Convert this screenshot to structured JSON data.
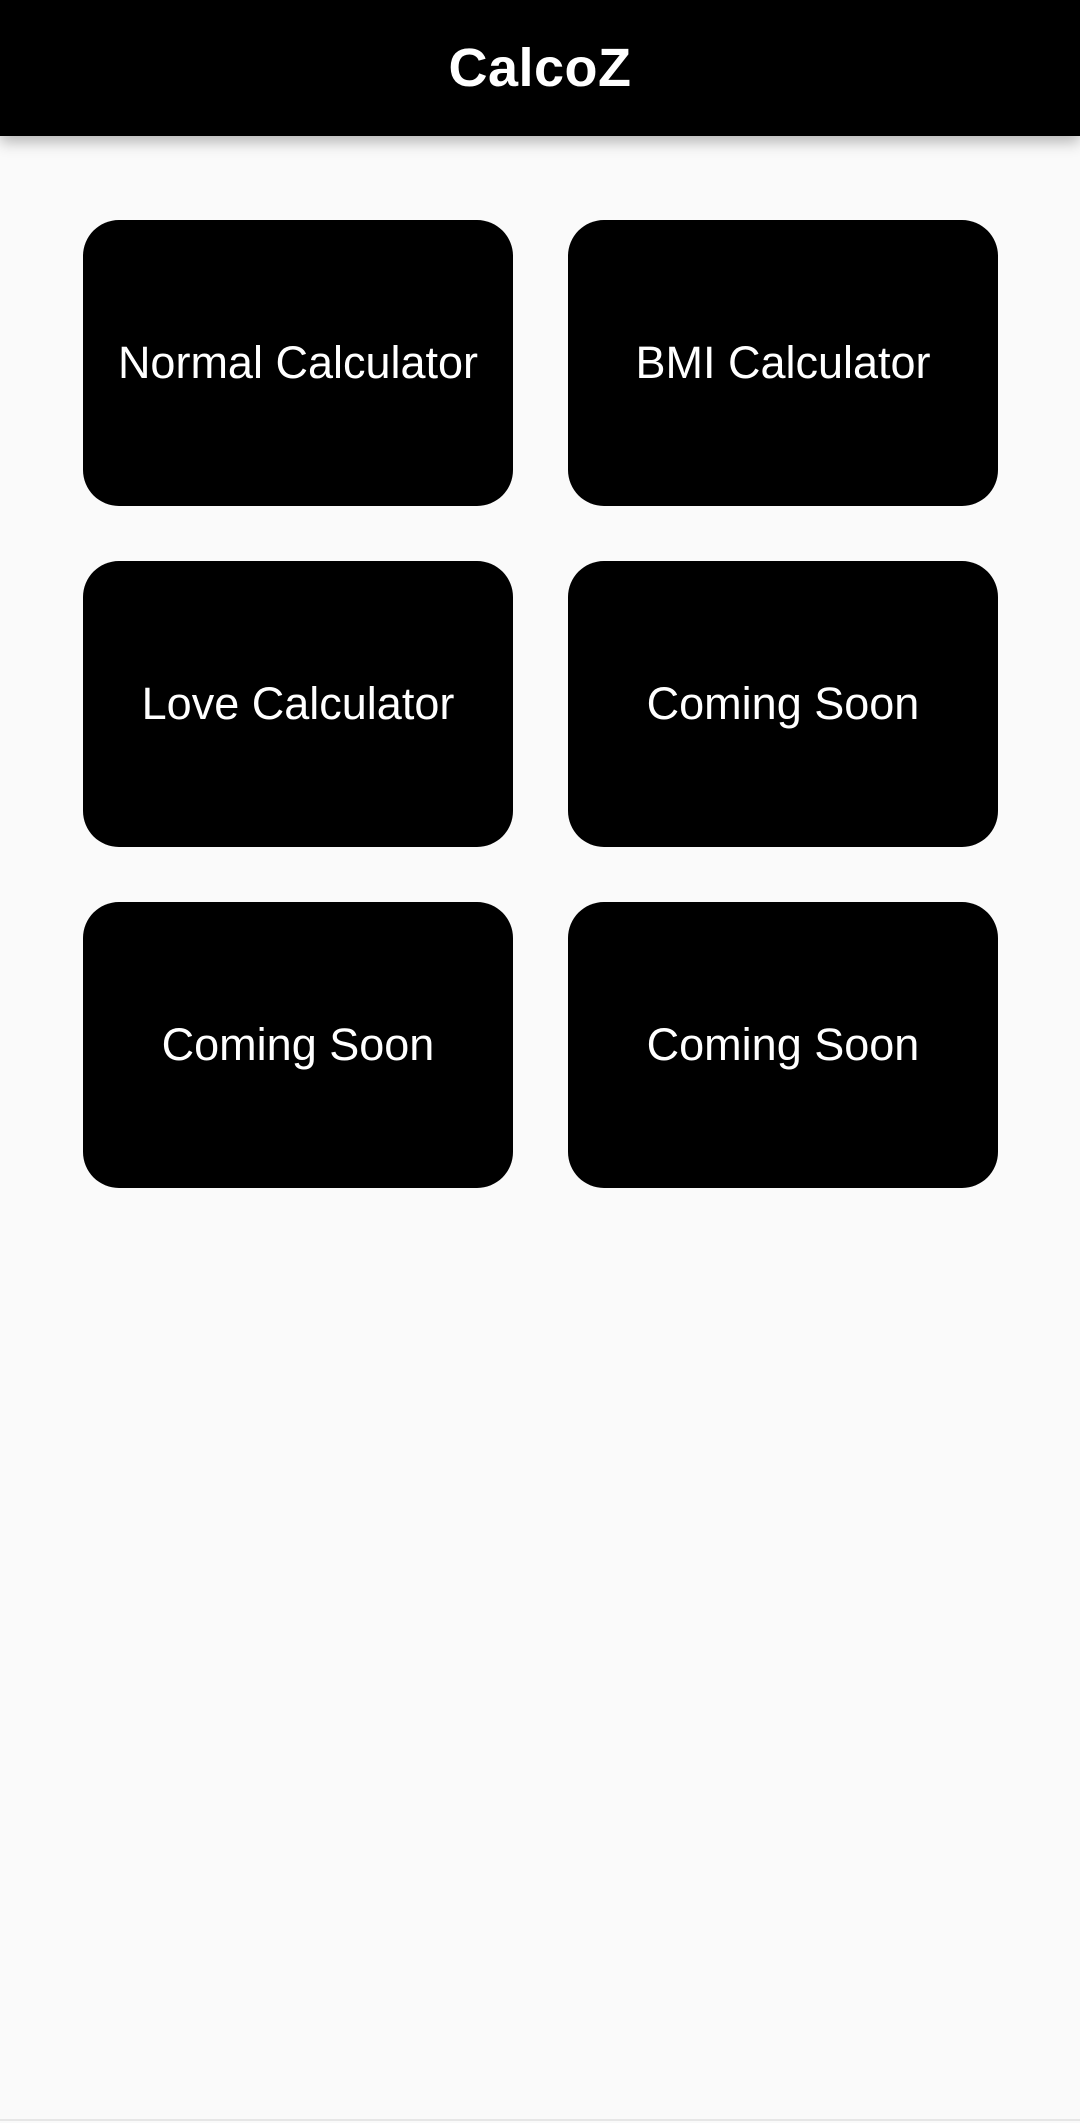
{
  "app": {
    "title": "CalcoZ"
  },
  "tiles": [
    {
      "label": "Normal Calculator"
    },
    {
      "label": "BMI Calculator"
    },
    {
      "label": "Love Calculator"
    },
    {
      "label": "Coming Soon"
    },
    {
      "label": "Coming Soon"
    },
    {
      "label": "Coming Soon"
    }
  ],
  "colors": {
    "app_bar": "#000000",
    "tile": "#000000",
    "background": "#fafafa",
    "text": "#ffffff"
  }
}
